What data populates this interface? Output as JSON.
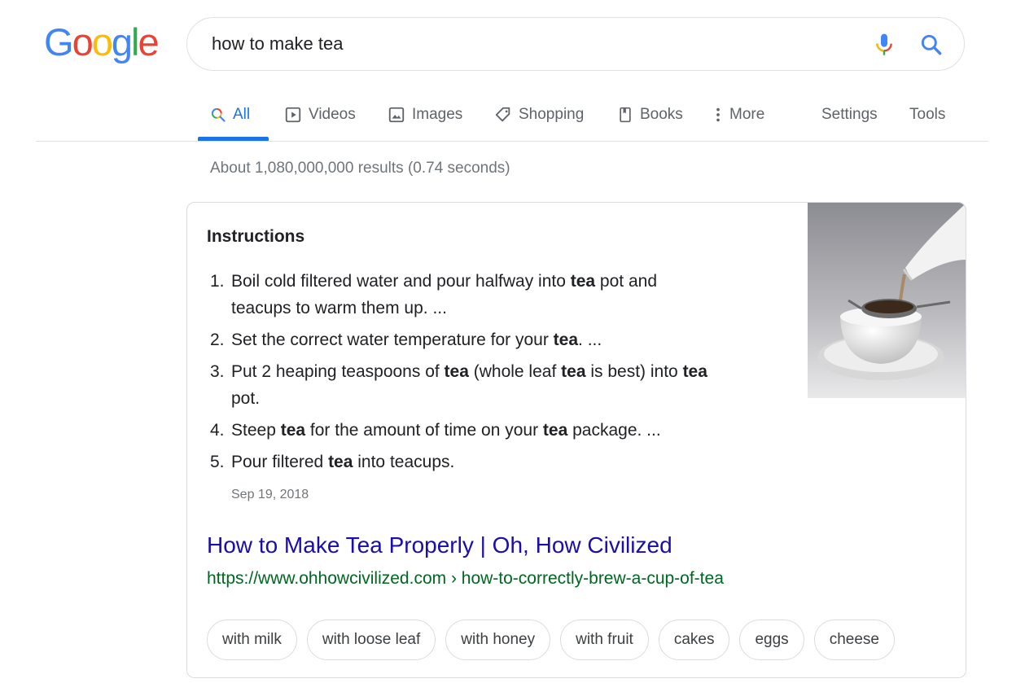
{
  "logo": {
    "letters": [
      "G",
      "o",
      "o",
      "g",
      "l",
      "e"
    ],
    "colors": [
      "#4285f4",
      "#ea4335",
      "#fbbc05",
      "#4285f4",
      "#34a853",
      "#ea4335"
    ]
  },
  "search": {
    "query": "how to make tea",
    "mic_icon": "microphone-icon",
    "search_icon": "magnifier-icon"
  },
  "tabs": [
    {
      "label": "All",
      "icon": "search-icon",
      "active": true
    },
    {
      "label": "Videos",
      "icon": "play-icon"
    },
    {
      "label": "Images",
      "icon": "image-icon"
    },
    {
      "label": "Shopping",
      "icon": "tag-icon"
    },
    {
      "label": "Books",
      "icon": "book-icon"
    },
    {
      "label": "More",
      "icon": "kebab-icon"
    },
    {
      "label": "Settings"
    },
    {
      "label": "Tools"
    }
  ],
  "result_stats": "About 1,080,000,000 results (0.74 seconds)",
  "snippet": {
    "heading": "Instructions",
    "steps": [
      [
        "Boil cold filtered water and pour halfway into ",
        {
          "b": "tea"
        },
        " pot and\nteacups to warm them up. ..."
      ],
      [
        "Set the correct water temperature for your ",
        {
          "b": "tea"
        },
        ". ..."
      ],
      [
        "Put 2 heaping teaspoons of ",
        {
          "b": "tea"
        },
        " (whole leaf ",
        {
          "b": "tea"
        },
        " is best) into ",
        {
          "b": "tea"
        },
        "\npot."
      ],
      [
        "Steep ",
        {
          "b": "tea"
        },
        " for the amount of time on your ",
        {
          "b": "tea"
        },
        " package. ..."
      ],
      [
        "Pour filtered ",
        {
          "b": "tea"
        },
        " into teacups."
      ]
    ],
    "date": "Sep 19, 2018",
    "title": "How to Make Tea Properly | Oh, How Civilized",
    "url": "https://www.ohhowcivilized.com › how-to-correctly-brew-a-cup-of-tea"
  },
  "chips": [
    "with milk",
    "with loose leaf",
    "with honey",
    "with fruit",
    "cakes",
    "eggs",
    "cheese"
  ],
  "colors": {
    "accent": "#1a73e8",
    "link": "#1a0dab",
    "url": "#006621",
    "muted": "#70757a"
  }
}
